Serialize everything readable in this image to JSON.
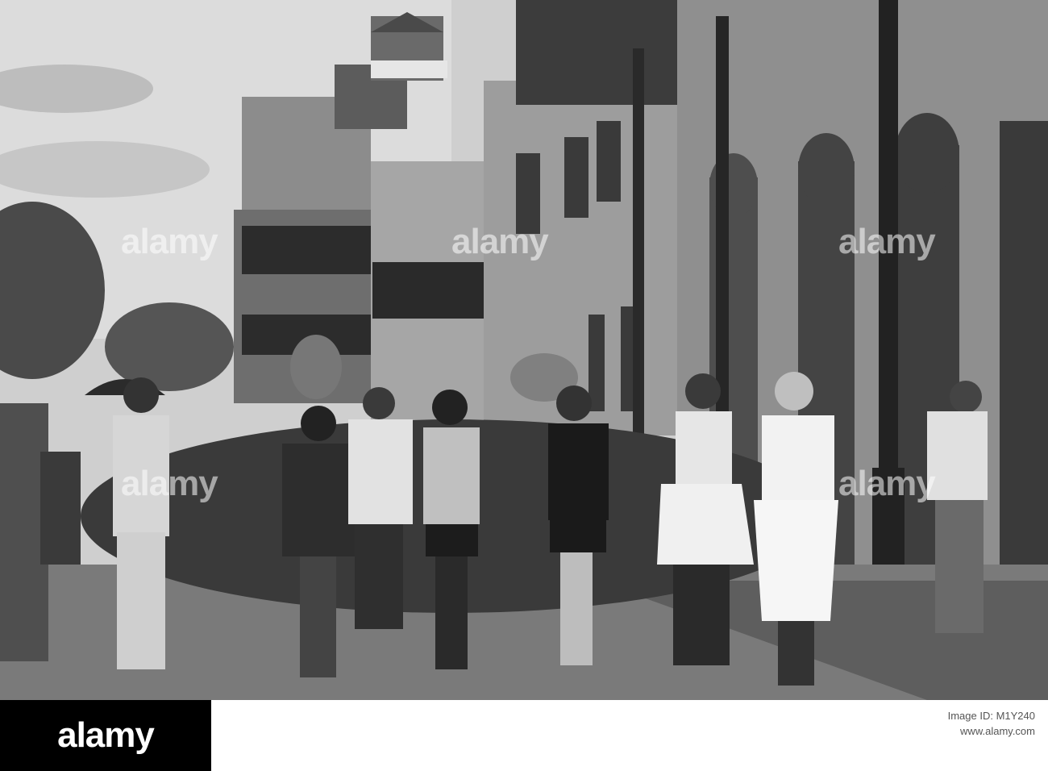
{
  "photo": {
    "subject": "street-parade-brass-band",
    "tone": "black-and-white",
    "colors": {
      "sky": "#d8d8d8",
      "street": "#7d7d7d",
      "buildings_dark": "#3a3a3a",
      "buildings_light": "#9a9a9a",
      "figures": "#1e1e1e"
    }
  },
  "watermarks": [
    "alamy",
    "alamy",
    "alamy",
    "alamy",
    "alamy"
  ],
  "footer": {
    "logo": "alamy",
    "image_id_label": "Image ID: M1Y240",
    "site": "www.alamy.com"
  }
}
